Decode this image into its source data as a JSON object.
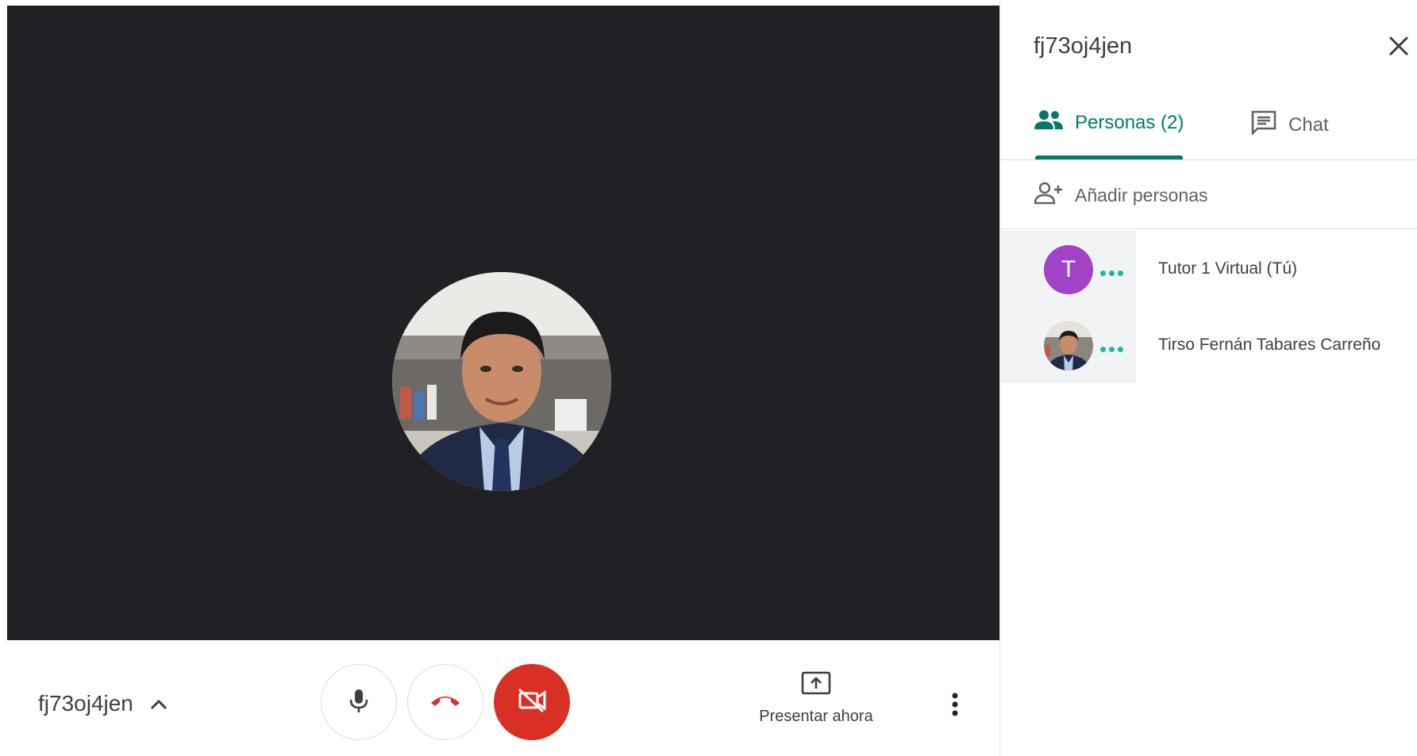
{
  "meeting": {
    "code": "fj73oj4jen"
  },
  "controls": {
    "mic": "mic-icon",
    "hangup": "call-end-icon",
    "camera": "videocam-off-icon",
    "present_label": "Presentar ahora",
    "more": "more-vert-icon"
  },
  "panel": {
    "title": "fj73oj4jen",
    "tabs": [
      {
        "label": "Personas (2)",
        "icon": "people-icon",
        "active": true
      },
      {
        "label": "Chat",
        "icon": "chat-icon",
        "active": false
      }
    ],
    "add_people_label": "Añadir personas",
    "participants": [
      {
        "name": "Tutor 1 Virtual (Tú)",
        "initial": "T",
        "avatar_color": "#a142c7"
      },
      {
        "name": "Tirso Fernán Tabares Carreño",
        "initial": "",
        "avatar_color": ""
      }
    ]
  },
  "colors": {
    "accent": "#00796b",
    "stage_bg": "#202124",
    "danger": "#d93025",
    "status_dots": "#1fb8a5"
  }
}
